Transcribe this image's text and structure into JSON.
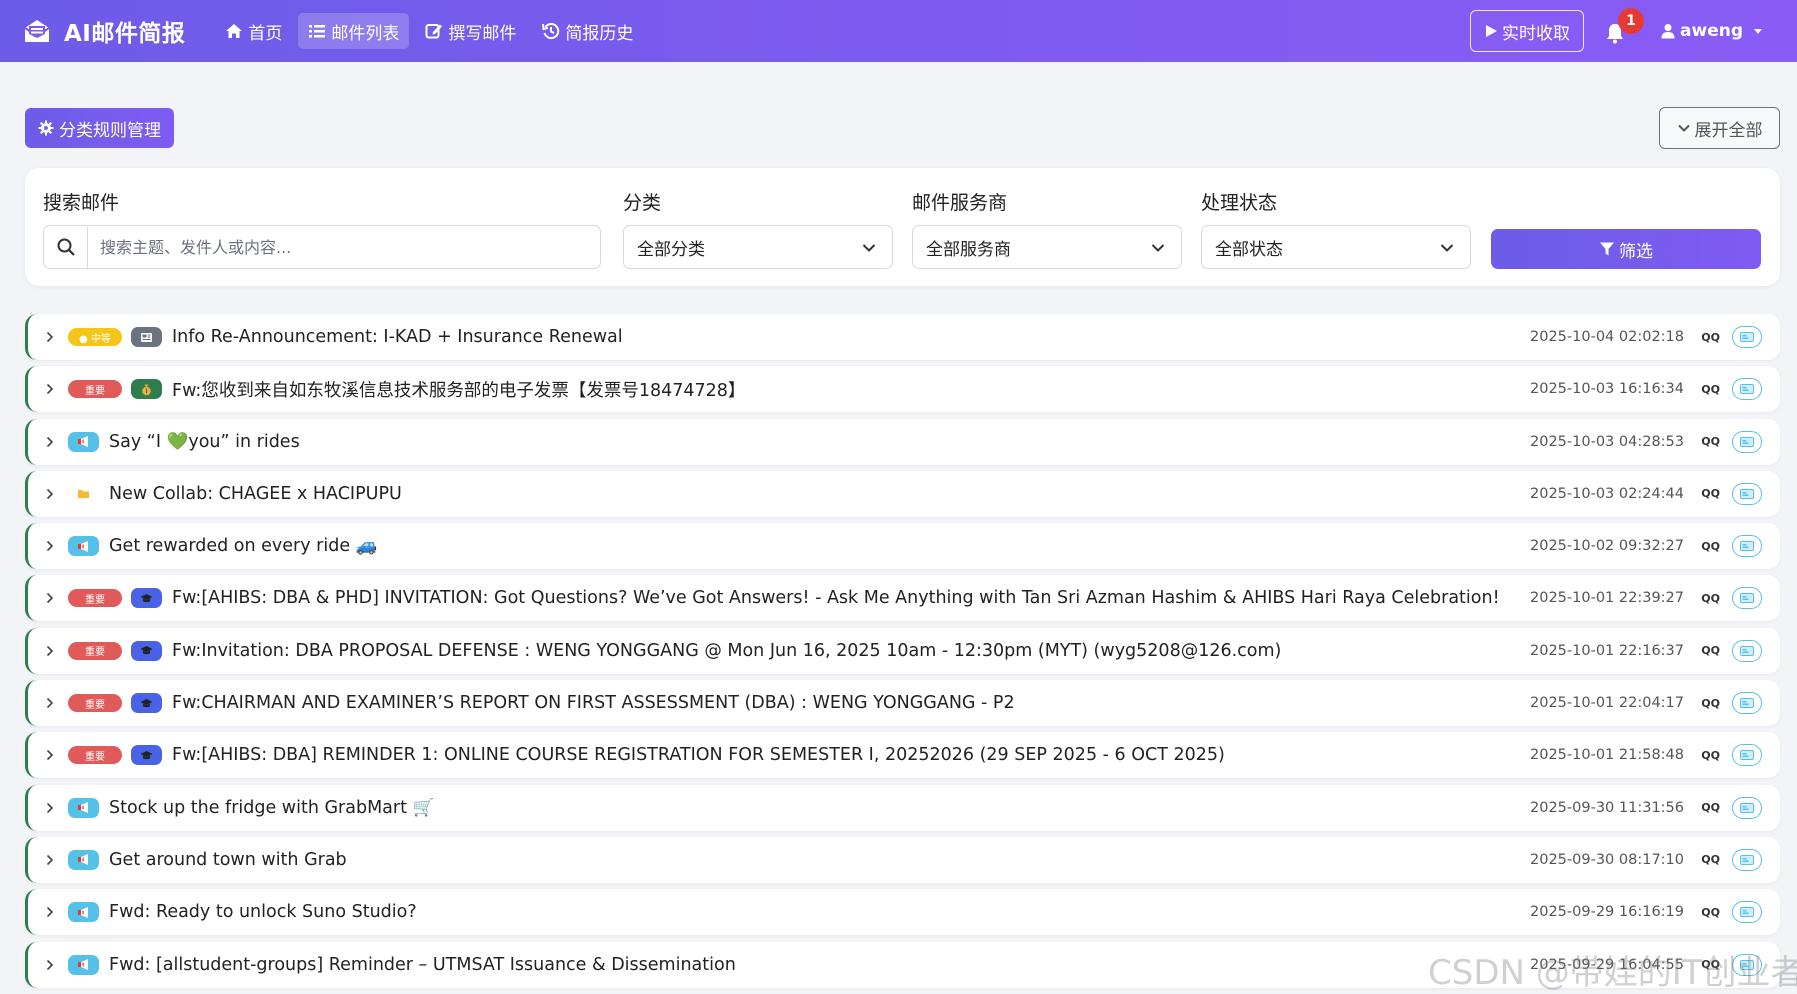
{
  "navbar": {
    "brand": "AI邮件简报",
    "links": [
      {
        "label": "首页",
        "icon": "home-icon",
        "active": false
      },
      {
        "label": "邮件列表",
        "icon": "list-icon",
        "active": true
      },
      {
        "label": "撰写邮件",
        "icon": "edit-icon",
        "active": false
      },
      {
        "label": "简报历史",
        "icon": "history-icon",
        "active": false
      }
    ],
    "realtime_label": "实时收取",
    "notification_count": "1",
    "username": "aweng"
  },
  "toolbar": {
    "rules_label": "分类规则管理",
    "expand_label": "展开全部"
  },
  "filters": {
    "search_label": "搜索邮件",
    "search_placeholder": "搜索主题、发件人或内容...",
    "category_label": "分类",
    "category_value": "全部分类",
    "provider_label": "邮件服务商",
    "provider_value": "全部服务商",
    "status_label": "处理状态",
    "status_value": "全部状态",
    "filter_button": "筛选"
  },
  "colors": {
    "accent": "#6c5ce7",
    "priority_medium": "#f5c518",
    "priority_high": "#e05a5a",
    "row_border": "#2e7d4f",
    "status_border": "#56c1e8"
  },
  "mails": [
    {
      "priority": "中等",
      "priority_type": "medium",
      "category": "gray",
      "category_icon": "newspaper-icon",
      "subject": "Info Re-Announcement: I-KAD + Insurance Renewal",
      "date": "2025-10-04 02:02:18",
      "provider": "QQ"
    },
    {
      "priority": "重要",
      "priority_type": "high",
      "category": "green",
      "category_icon": "money-bag-icon",
      "subject": "Fw:您收到来自如东牧溪信息技术服务部的电子发票【发票号18474728】",
      "date": "2025-10-03 16:16:34",
      "provider": "QQ"
    },
    {
      "priority": "",
      "priority_type": "none",
      "category": "cyan",
      "category_icon": "megaphone-icon",
      "subject": "Say “I 💚you” in rides",
      "date": "2025-10-03 04:28:53",
      "provider": "QQ"
    },
    {
      "priority": "",
      "priority_type": "none",
      "category": "plain",
      "category_icon": "folder-icon",
      "subject": "New Collab: CHAGEE x HACIPUPU",
      "date": "2025-10-03 02:24:44",
      "provider": "QQ"
    },
    {
      "priority": "",
      "priority_type": "none",
      "category": "cyan",
      "category_icon": "megaphone-icon",
      "subject": "Get rewarded on every ride 🚙",
      "date": "2025-10-02 09:32:27",
      "provider": "QQ"
    },
    {
      "priority": "重要",
      "priority_type": "high",
      "category": "blue",
      "category_icon": "graduation-cap-icon",
      "subject": "Fw:[AHIBS: DBA & PHD] INVITATION: Got Questions? We’ve Got Answers! - Ask Me Anything with Tan Sri Azman Hashim & AHIBS Hari Raya Celebration!",
      "date": "2025-10-01 22:39:27",
      "provider": "QQ"
    },
    {
      "priority": "重要",
      "priority_type": "high",
      "category": "blue",
      "category_icon": "graduation-cap-icon",
      "subject": "Fw:Invitation: DBA PROPOSAL DEFENSE : WENG YONGGANG @ Mon Jun 16, 2025 10am - 12:30pm (MYT) (wyg5208@126.com)",
      "date": "2025-10-01 22:16:37",
      "provider": "QQ"
    },
    {
      "priority": "重要",
      "priority_type": "high",
      "category": "blue",
      "category_icon": "graduation-cap-icon",
      "subject": "Fw:CHAIRMAN AND EXAMINER’S REPORT ON FIRST ASSESSMENT (DBA) : WENG YONGGANG - P2",
      "date": "2025-10-01 22:04:17",
      "provider": "QQ"
    },
    {
      "priority": "重要",
      "priority_type": "high",
      "category": "blue",
      "category_icon": "graduation-cap-icon",
      "subject": "Fw:[AHIBS: DBA] REMINDER 1: ONLINE COURSE REGISTRATION FOR SEMESTER I, 20252026 (29 SEP 2025 - 6 OCT 2025)",
      "date": "2025-10-01 21:58:48",
      "provider": "QQ"
    },
    {
      "priority": "",
      "priority_type": "none",
      "category": "cyan",
      "category_icon": "megaphone-icon",
      "subject": "Stock up the fridge with GrabMart 🛒",
      "date": "2025-09-30 11:31:56",
      "provider": "QQ"
    },
    {
      "priority": "",
      "priority_type": "none",
      "category": "cyan",
      "category_icon": "megaphone-icon",
      "subject": "Get around town with Grab",
      "date": "2025-09-30 08:17:10",
      "provider": "QQ"
    },
    {
      "priority": "",
      "priority_type": "none",
      "category": "cyan",
      "category_icon": "megaphone-icon",
      "subject": "Fwd: Ready to unlock Suno Studio?",
      "date": "2025-09-29 16:16:19",
      "provider": "QQ"
    },
    {
      "priority": "",
      "priority_type": "none",
      "category": "cyan",
      "category_icon": "megaphone-icon",
      "subject": "Fwd: [allstudent-groups] Reminder – UTMSAT Issuance & Dissemination",
      "date": "2025-09-29 16:04:55",
      "provider": "QQ"
    }
  ],
  "watermark": "CSDN @带娃的IT创业者"
}
